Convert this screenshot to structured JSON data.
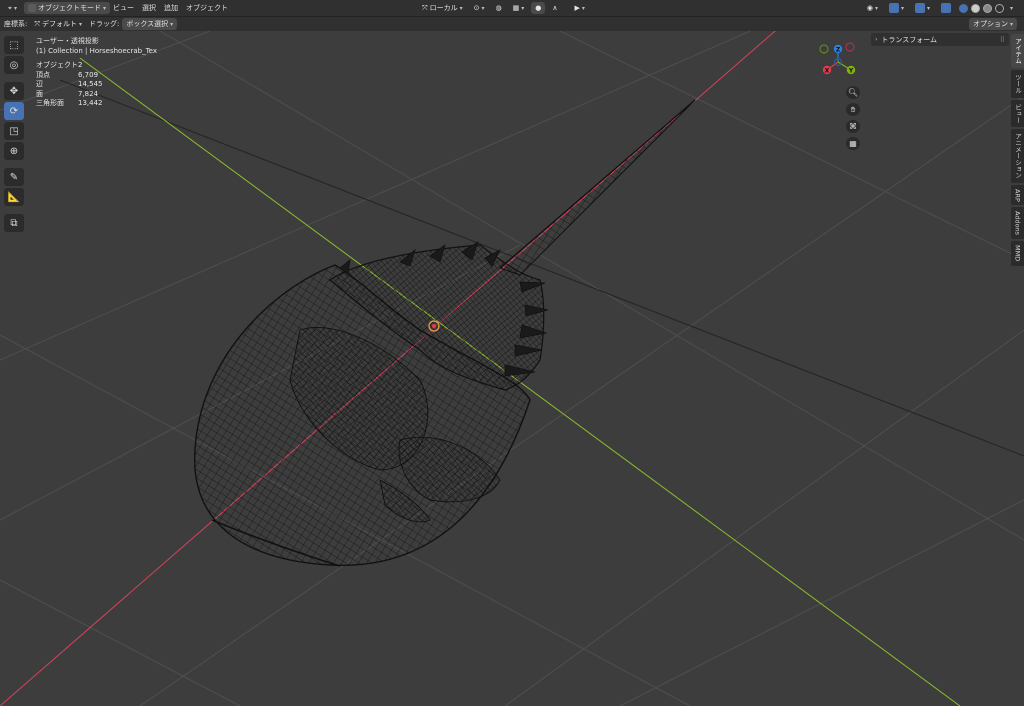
{
  "header": {
    "mode_label": "オブジェクトモード",
    "menus": [
      "ビュー",
      "選択",
      "追加",
      "オブジェクト"
    ],
    "transform_orientation": "ローカル",
    "options_label": "オプション"
  },
  "subheader": {
    "coord_label": "座標系:",
    "coord_value": "デフォルト",
    "drag_label": "ドラッグ:",
    "drag_value": "ボックス選択"
  },
  "viewport_info": {
    "view_name": "ユーザー・透視投影",
    "collection": "(1) Collection | Horseshoecrab_Tex",
    "stats": [
      {
        "label": "オブジェクト",
        "value": "2"
      },
      {
        "label": "頂点",
        "value": "6,709"
      },
      {
        "label": "辺",
        "value": "14,545"
      },
      {
        "label": "面",
        "value": "7,824"
      },
      {
        "label": "三角形面",
        "value": "13,442"
      }
    ]
  },
  "gizmo": {
    "axes": [
      {
        "label": "Z",
        "color": "#2f7fde"
      },
      {
        "label": "X",
        "color": "#e23a4f"
      },
      {
        "label": "Y",
        "color": "#7fb30b"
      }
    ]
  },
  "n_panel": {
    "header": "トランスフォーム",
    "tabs": [
      "アイテム",
      "ツール",
      "ビュー",
      "アニメーション",
      "ARP",
      "Addons",
      "MMD"
    ]
  },
  "tools": [
    "select-box",
    "cursor",
    "move",
    "rotate",
    "scale",
    "transform",
    "annotate",
    "measure",
    "add-cube"
  ],
  "colors": {
    "background": "#3d3d3d",
    "accent": "#4772b3",
    "x_axis": "#d9425a",
    "y_axis": "#8bbf2a"
  }
}
